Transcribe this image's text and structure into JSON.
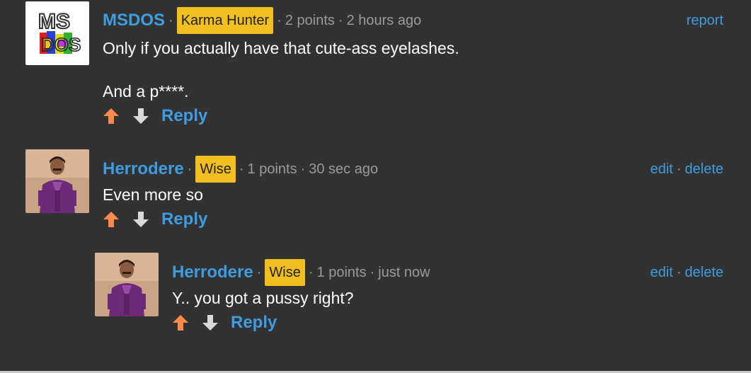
{
  "comments": [
    {
      "username": "MSDOS",
      "badge": "Karma Hunter",
      "points": "2 points",
      "time": "2 hours ago",
      "actions": [
        "report"
      ],
      "lines": [
        "Only if you actually have that cute-ass eyelashes.",
        "And a p****."
      ],
      "reply_label": "Reply",
      "avatar_icon": "msdos-logo-icon"
    },
    {
      "username": "Herrodere",
      "badge": "Wise",
      "points": "1 points",
      "time": "30 sec ago",
      "actions": [
        "edit",
        "delete"
      ],
      "lines": [
        "Even more so"
      ],
      "reply_label": "Reply",
      "avatar_icon": "user-photo-avatar"
    },
    {
      "username": "Herrodere",
      "badge": "Wise",
      "points": "1 points",
      "time": "just now",
      "actions": [
        "edit",
        "delete"
      ],
      "lines": [
        "Y.. you got a pussy right?"
      ],
      "reply_label": "Reply",
      "avatar_icon": "user-photo-avatar"
    }
  ],
  "separator": "·",
  "colors": {
    "background": "#323232",
    "link": "#3e9ce0",
    "badge": "#f2c01e",
    "upvote": "#ff8a4c",
    "downvote": "#d9d9d9",
    "meta": "#9a9a9a"
  }
}
